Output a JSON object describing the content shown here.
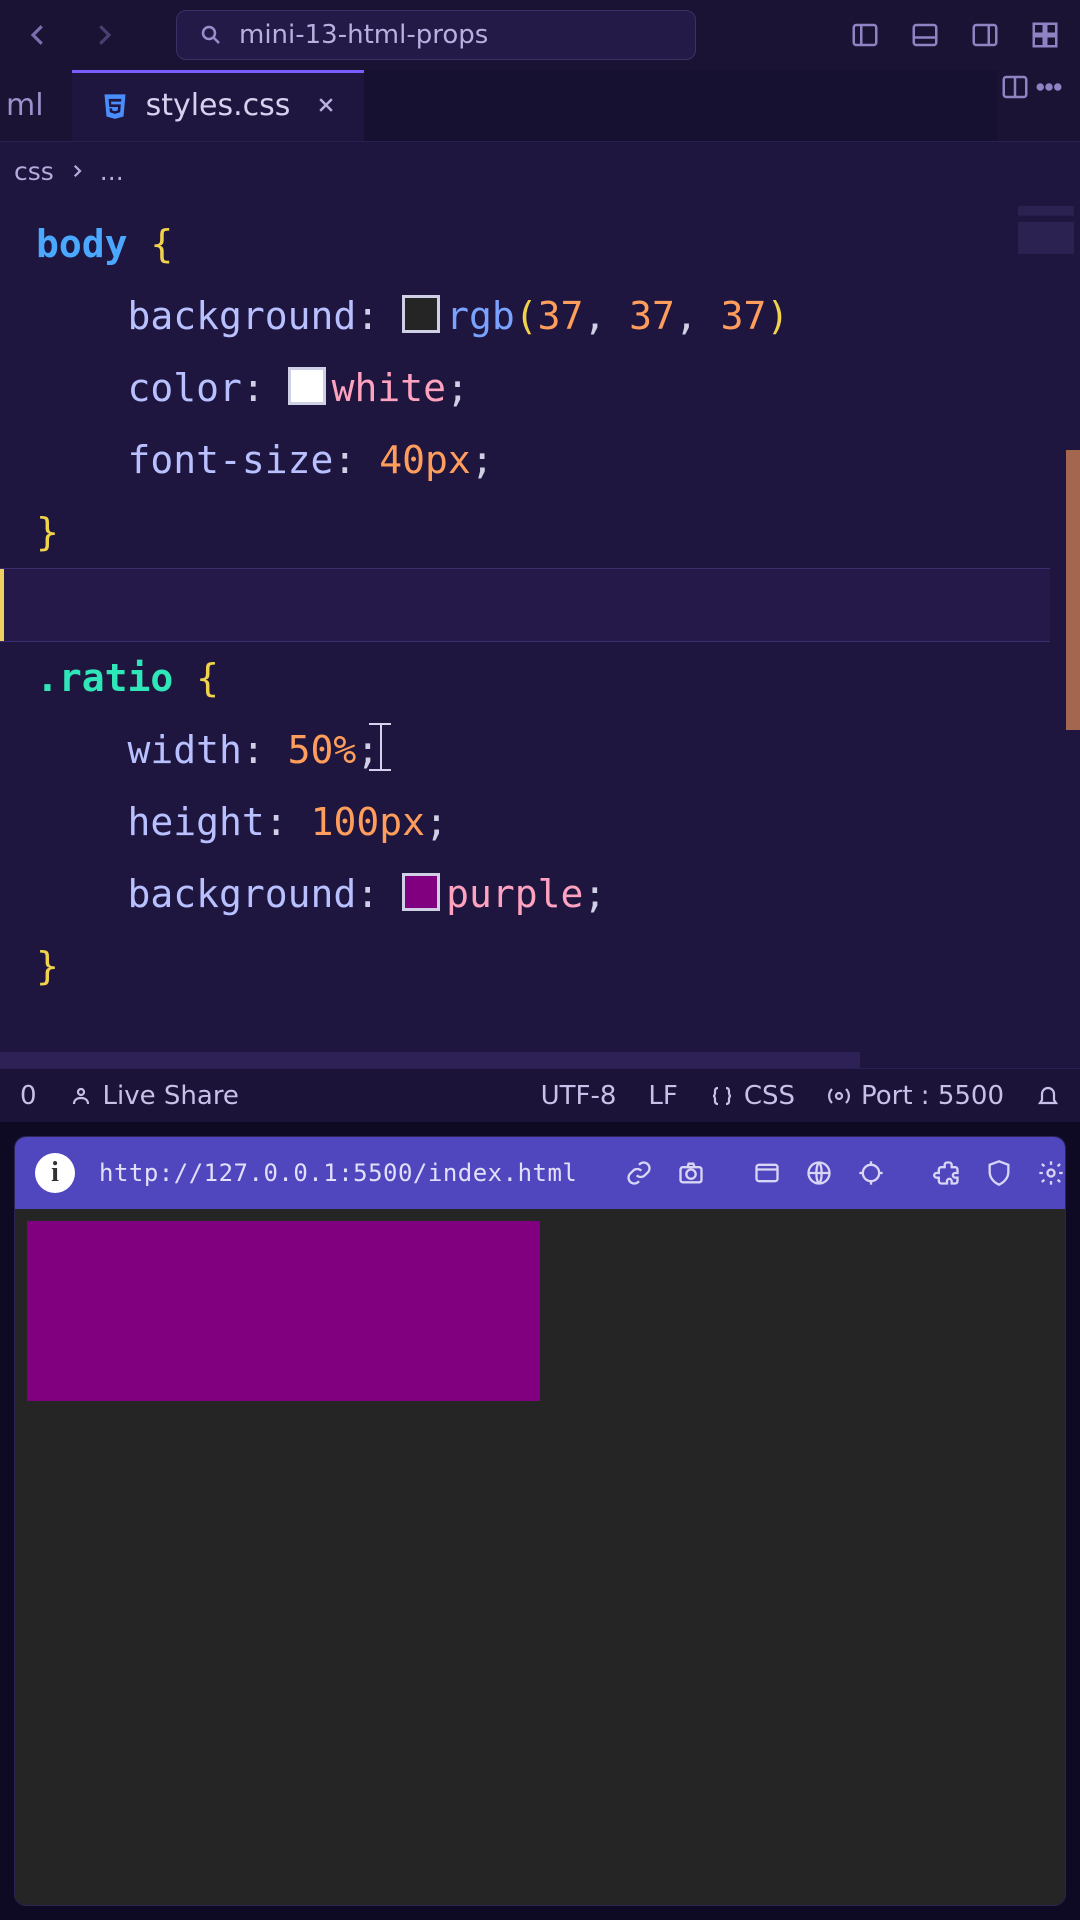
{
  "titlebar": {
    "search_text": "mini-13-html-props"
  },
  "tabs": {
    "prev_partial": "ml",
    "active_filename": "styles.css"
  },
  "breadcrumb": {
    "item0": "css",
    "item1": "..."
  },
  "code": {
    "l1_sel": "body",
    "l1_brace": " {",
    "indent": "    ",
    "l2_prop": "background",
    "l2_colon": ": ",
    "l2_func": "rgb",
    "l2_open": "(",
    "l2_n1": "37",
    "l2_c1": ", ",
    "l2_n2": "37",
    "l2_c2": ", ",
    "l2_n3": "37",
    "l2_close": ")",
    "l3_prop": "color",
    "l3_val": "white",
    "l3_semi": ";",
    "l4_prop": "font-size",
    "l4_val": "40px",
    "l4_semi": ";",
    "l5_brace": "}",
    "l7_sel": ".ratio",
    "l7_brace": " {",
    "l8_prop": "width",
    "l8_val": "50%",
    "l8_semi": ";",
    "l9_prop": "height",
    "l9_val": "100px",
    "l9_semi": ";",
    "l10_prop": "background",
    "l10_val": "purple",
    "l10_semi": ";",
    "l11_brace": "}"
  },
  "swatches": {
    "body_bg": "#252525",
    "body_color": "#ffffff",
    "ratio_bg": "#800080"
  },
  "statusbar": {
    "left_partial": "0",
    "liveshare": "Live Share",
    "encoding": "UTF-8",
    "eol": "LF",
    "lang": "CSS",
    "port": "Port : 5500"
  },
  "preview": {
    "url": "http://127.0.0.1:5500/index.html",
    "info_glyph": "i"
  }
}
